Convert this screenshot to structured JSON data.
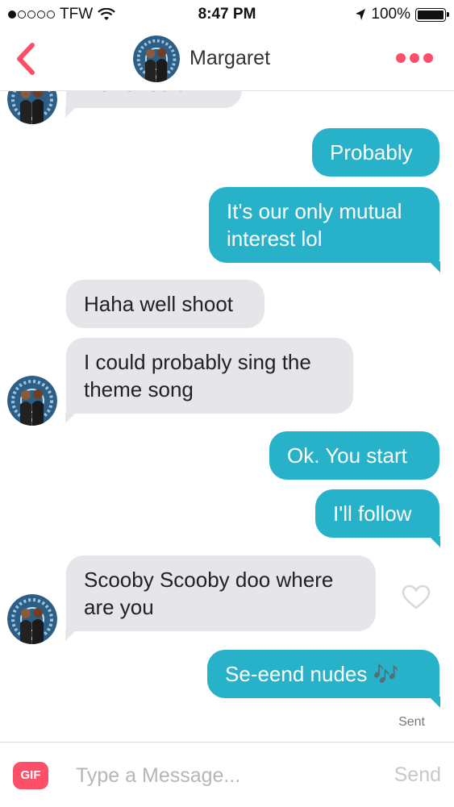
{
  "status_bar": {
    "carrier": "TFW",
    "time": "8:47 PM",
    "battery": "100%"
  },
  "header": {
    "contact_name": "Margaret"
  },
  "messages": [
    {
      "from": "them",
      "text": "No. Should I?"
    },
    {
      "from": "me",
      "text": "Probably"
    },
    {
      "from": "me",
      "text": "It's our only mutual interest lol"
    },
    {
      "from": "them",
      "text": "Haha well shoot"
    },
    {
      "from": "them",
      "text": "I could probably sing the theme song"
    },
    {
      "from": "me",
      "text": "Ok. You start"
    },
    {
      "from": "me",
      "text": "I'll follow"
    },
    {
      "from": "them",
      "text": "Scooby Scooby doo where are you"
    },
    {
      "from": "me",
      "text": "Se-eend nudes 🎶"
    }
  ],
  "delivery_status": "Sent",
  "composer": {
    "gif_label": "GIF",
    "placeholder": "Type a Message...",
    "send_label": "Send"
  },
  "colors": {
    "accent": "#fd5068",
    "outgoing_bubble": "#28b2c9",
    "incoming_bubble": "#e5e5ea"
  },
  "icons": [
    "back-chevron-icon",
    "more-dots-icon",
    "heart-outline-icon",
    "wifi-icon",
    "location-arrow-icon",
    "battery-icon"
  ]
}
